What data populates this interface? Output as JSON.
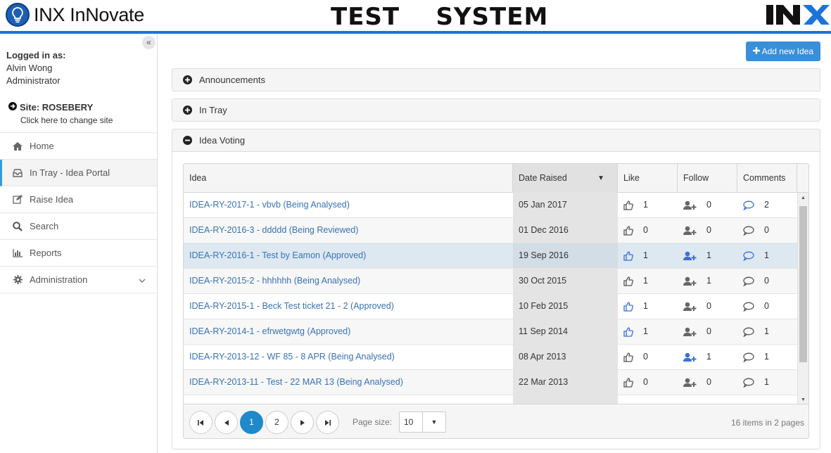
{
  "header": {
    "logo_text": "INX InNovate",
    "system_title": "TEST    SYSTEM",
    "brand_mark": "INX"
  },
  "sidebar": {
    "collapse_glyph": "«",
    "logged_in_label": "Logged in as:",
    "user_name": "Alvin Wong",
    "user_role": "Administrator",
    "site_label": "Site: ROSEBERY",
    "site_change": "Click here to change site",
    "items": [
      {
        "label": "Home",
        "icon": "home-icon"
      },
      {
        "label": "In Tray - Idea Portal",
        "icon": "inbox-icon",
        "active": true
      },
      {
        "label": "Raise Idea",
        "icon": "edit-icon"
      },
      {
        "label": "Search",
        "icon": "search-icon"
      },
      {
        "label": "Reports",
        "icon": "bar-chart-icon"
      },
      {
        "label": "Administration",
        "icon": "gear-icon"
      }
    ]
  },
  "main": {
    "add_button": "Add new Idea",
    "panels": {
      "announcements": "Announcements",
      "in_tray": "In Tray",
      "idea_voting": "Idea Voting"
    },
    "grid": {
      "headers": {
        "idea": "Idea",
        "date": "Date Raised",
        "like": "Like",
        "follow": "Follow",
        "comments": "Comments"
      },
      "sort_glyph": "▼",
      "rows": [
        {
          "idea": "IDEA-RY-2017-1 - vbvb (Being Analysed)",
          "date": "05 Jan 2017",
          "likes": "1",
          "liked": false,
          "follows": "0",
          "followed": false,
          "comments": "2",
          "commented": true
        },
        {
          "idea": "IDEA-RY-2016-3 - ddddd (Being Reviewed)",
          "date": "01 Dec 2016",
          "likes": "0",
          "liked": false,
          "follows": "0",
          "followed": false,
          "comments": "0",
          "commented": false
        },
        {
          "idea": "IDEA-RY-2016-1 - Test by Eamon (Approved)",
          "date": "19 Sep 2016",
          "likes": "1",
          "liked": true,
          "follows": "1",
          "followed": true,
          "comments": "1",
          "commented": true
        },
        {
          "idea": "IDEA-RY-2015-2 - hhhhhh (Being Analysed)",
          "date": "30 Oct 2015",
          "likes": "1",
          "liked": false,
          "follows": "1",
          "followed": false,
          "comments": "0",
          "commented": false
        },
        {
          "idea": "IDEA-RY-2015-1 - Beck Test ticket 21 - 2 (Approved)",
          "date": "10 Feb 2015",
          "likes": "1",
          "liked": true,
          "follows": "0",
          "followed": false,
          "comments": "0",
          "commented": false
        },
        {
          "idea": "IDEA-RY-2014-1 - efrwetgwtg (Approved)",
          "date": "11 Sep 2014",
          "likes": "1",
          "liked": true,
          "follows": "0",
          "followed": false,
          "comments": "1",
          "commented": false
        },
        {
          "idea": "IDEA-RY-2013-12 - WF 85 - 8 APR (Being Analysed)",
          "date": "08 Apr 2013",
          "likes": "0",
          "liked": false,
          "follows": "1",
          "followed": true,
          "comments": "1",
          "commented": false
        },
        {
          "idea": "IDEA-RY-2013-11 - Test - 22 MAR 13 (Being Analysed)",
          "date": "22 Mar 2013",
          "likes": "0",
          "liked": false,
          "follows": "0",
          "followed": false,
          "comments": "1",
          "commented": false
        }
      ],
      "selected_row": 2
    },
    "pager": {
      "pages": [
        "1",
        "2"
      ],
      "current_page": "1",
      "page_size_label": "Page size:",
      "page_size": "10",
      "info": "16 items in 2 pages"
    }
  },
  "colors": {
    "accent": "#1e73d9",
    "link": "#3872b6",
    "active_icon": "#3a6fd8",
    "button": "#3a8fd8",
    "current_page": "#1f89c9"
  }
}
